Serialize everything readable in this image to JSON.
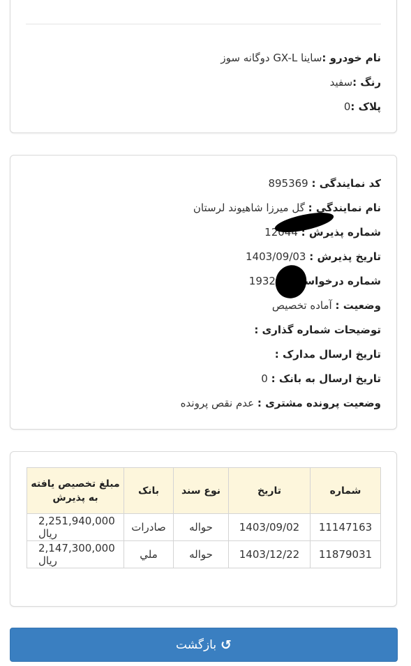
{
  "vehicle": {
    "model_label": "نام خودرو :",
    "model_value": "ساینا GX-L دوگانه سوز",
    "color_label": "رنگ :",
    "color_value": "سفید",
    "plate_label": "پلاک :",
    "plate_value": "0"
  },
  "agency": {
    "code_label": "کد نمایندگی :",
    "code_value": "895369",
    "name_label": "نام نمایندگی :",
    "name_value": "گل میرزا شاهیوند لرستان",
    "reception_no_label": "شماره پذیرش :",
    "reception_no_value": "12044",
    "reception_date_label": "تاریخ پذیرش :",
    "reception_date_value": "1403/09/03",
    "request_no_label": "شماره درخواست :",
    "request_no_value": "19327",
    "status_label": "وضعیت :",
    "status_value": "آماده تخصیص",
    "numbering_notes_label": "توضیحات شماره گذاری :",
    "numbering_notes_value": "",
    "docs_sent_date_label": "تاریخ ارسال مدارک :",
    "docs_sent_date_value": "",
    "bank_sent_date_label": "تاریخ ارسال به بانک :",
    "bank_sent_date_value": "0",
    "customer_file_status_label": "وضعیت پرونده مشتری :",
    "customer_file_status_value": "عدم نقص پرونده"
  },
  "allocation_table": {
    "headers": {
      "number": "شماره",
      "date": "تاریخ",
      "doc_type": "نوع سند",
      "bank": "بانک",
      "amount": "مبلغ تخصیص یافته به پذیرش"
    },
    "rows": [
      {
        "number": "11147163",
        "date": "1403/09/02",
        "doc_type": "حواله",
        "bank": "صادرات",
        "amount": "2,251,940,000 ریال"
      },
      {
        "number": "11879031",
        "date": "1403/12/22",
        "doc_type": "حواله",
        "bank": "ملي",
        "amount": "2,147,300,000 ریال"
      }
    ]
  },
  "actions": {
    "back_label": "بازگشت",
    "back_icon": "refresh-icon"
  },
  "colors": {
    "button_bg": "#3a7fc1",
    "table_header_bg": "#fdf6dc"
  }
}
